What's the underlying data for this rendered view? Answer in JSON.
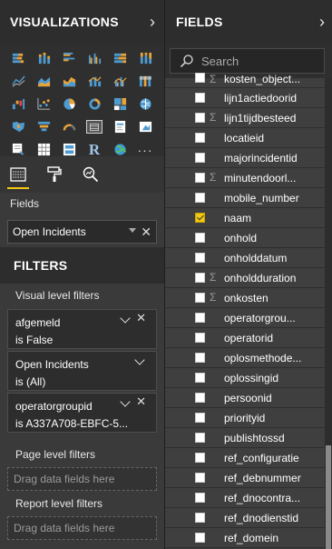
{
  "visualizations": {
    "title": "VISUALIZATIONS",
    "icons": [
      "stacked-bar-icon",
      "stacked-column-icon",
      "clustered-bar-icon",
      "clustered-column-icon",
      "100-stacked-bar-icon",
      "100-stacked-column-icon",
      "line-chart-icon",
      "area-chart-icon",
      "stacked-area-icon",
      "line-column-icon",
      "line-clustered-column-icon",
      "ribbon-chart-icon",
      "waterfall-icon",
      "scatter-icon",
      "pie-chart-icon",
      "donut-icon",
      "treemap-icon",
      "map-icon",
      "filled-map-icon",
      "funnel-icon",
      "gauge-icon",
      "table-icon",
      "card-icon",
      "kpi-icon",
      "slicer-icon",
      "matrix-icon",
      "multi-row-card-icon",
      "r-visual-icon",
      "globe-icon",
      "more-icon"
    ],
    "more_label": "···",
    "r_label": "R",
    "tools": [
      "fields-well-icon",
      "format-paintroller-icon",
      "analytics-magnifier-icon"
    ]
  },
  "fields_well": {
    "label": "Fields",
    "value": "Open Incidents"
  },
  "filters": {
    "title": "FILTERS",
    "visual_level_label": "Visual level filters",
    "cards": [
      {
        "name": "afgemeld",
        "value": "is False"
      },
      {
        "name": "Open Incidents",
        "value": "is (All)"
      },
      {
        "name": "operatorgroupid",
        "value": "is A337A708-EBFC-5..."
      }
    ],
    "page_level_label": "Page level filters",
    "report_level_label": "Report level filters",
    "drop_placeholder": "Drag data fields here"
  },
  "fields_pane": {
    "title": "FIELDS",
    "search_placeholder": "Search",
    "items": [
      {
        "label": "kosten_object...",
        "sigma": true,
        "checked": false
      },
      {
        "label": "lijn1actiedoorid",
        "sigma": false,
        "checked": false
      },
      {
        "label": "lijn1tijdbesteed",
        "sigma": true,
        "checked": false
      },
      {
        "label": "locatieid",
        "sigma": false,
        "checked": false
      },
      {
        "label": "majorincidentid",
        "sigma": false,
        "checked": false
      },
      {
        "label": "minutendoorl...",
        "sigma": true,
        "checked": false
      },
      {
        "label": "mobile_number",
        "sigma": false,
        "checked": false
      },
      {
        "label": "naam",
        "sigma": false,
        "checked": true
      },
      {
        "label": "onhold",
        "sigma": false,
        "checked": false
      },
      {
        "label": "onholddatum",
        "sigma": false,
        "checked": false
      },
      {
        "label": "onholdduration",
        "sigma": true,
        "checked": false
      },
      {
        "label": "onkosten",
        "sigma": true,
        "checked": false
      },
      {
        "label": "operatorgrou...",
        "sigma": false,
        "checked": false
      },
      {
        "label": "operatorid",
        "sigma": false,
        "checked": false
      },
      {
        "label": "oplosmethode...",
        "sigma": false,
        "checked": false
      },
      {
        "label": "oplossingid",
        "sigma": false,
        "checked": false
      },
      {
        "label": "persoonid",
        "sigma": false,
        "checked": false
      },
      {
        "label": "priorityid",
        "sigma": false,
        "checked": false
      },
      {
        "label": "publishtossd",
        "sigma": false,
        "checked": false
      },
      {
        "label": "ref_configuratie",
        "sigma": false,
        "checked": false
      },
      {
        "label": "ref_debnummer",
        "sigma": false,
        "checked": false
      },
      {
        "label": "ref_dnocontra...",
        "sigma": false,
        "checked": false
      },
      {
        "label": "ref_dnodienstid",
        "sigma": false,
        "checked": false
      },
      {
        "label": "ref_domein",
        "sigma": false,
        "checked": false
      }
    ]
  },
  "colors": {
    "accent": "#f2c811",
    "pane_bg": "#3a3a3a",
    "header_bg": "#2d2d2d"
  }
}
